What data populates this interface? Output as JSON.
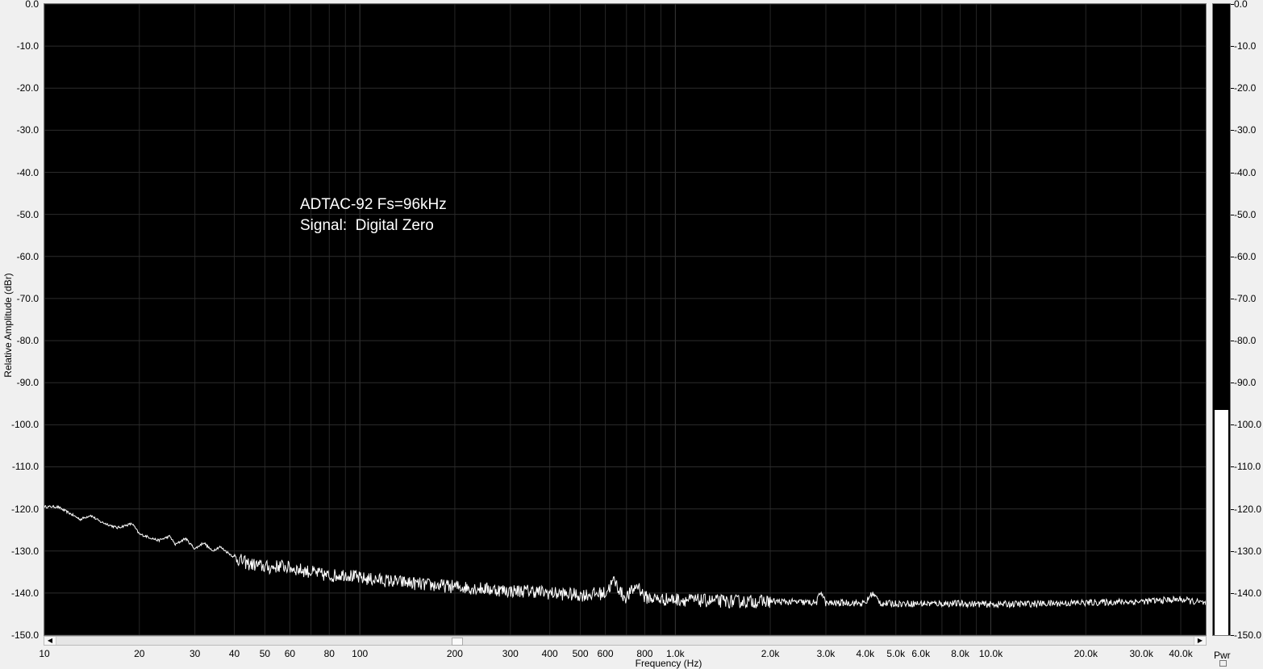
{
  "chart_data": {
    "type": "line",
    "xscale": "log",
    "xlim": [
      10,
      48000
    ],
    "ylim": [
      -150,
      0
    ],
    "ylabel": "Relative Amplitude (dBr)",
    "xlabel": "Frequency (Hz)",
    "grid": true,
    "y_ticks": [
      "0.0",
      "-10.0",
      "-20.0",
      "-30.0",
      "-40.0",
      "-50.0",
      "-60.0",
      "-70.0",
      "-80.0",
      "-90.0",
      "-100.0",
      "-110.0",
      "-120.0",
      "-130.0",
      "-140.0",
      "-150.0"
    ],
    "y_tick_values": [
      0,
      -10,
      -20,
      -30,
      -40,
      -50,
      -60,
      -70,
      -80,
      -90,
      -100,
      -110,
      -120,
      -130,
      -140,
      -150
    ],
    "x_ticks": [
      {
        "v": 10,
        "label": "10"
      },
      {
        "v": 20,
        "label": "20"
      },
      {
        "v": 30,
        "label": "30"
      },
      {
        "v": 40,
        "label": "40"
      },
      {
        "v": 50,
        "label": "50"
      },
      {
        "v": 60,
        "label": "60"
      },
      {
        "v": 80,
        "label": "80"
      },
      {
        "v": 100,
        "label": "100"
      },
      {
        "v": 200,
        "label": "200"
      },
      {
        "v": 300,
        "label": "300"
      },
      {
        "v": 400,
        "label": "400"
      },
      {
        "v": 500,
        "label": "500"
      },
      {
        "v": 600,
        "label": "600"
      },
      {
        "v": 800,
        "label": "800"
      },
      {
        "v": 1000,
        "label": "1.0k"
      },
      {
        "v": 2000,
        "label": "2.0k"
      },
      {
        "v": 3000,
        "label": "3.0k"
      },
      {
        "v": 4000,
        "label": "4.0k"
      },
      {
        "v": 5000,
        "label": "5.0k"
      },
      {
        "v": 6000,
        "label": "6.0k"
      },
      {
        "v": 8000,
        "label": "8.0k"
      },
      {
        "v": 10000,
        "label": "10.0k"
      },
      {
        "v": 20000,
        "label": "20.0k"
      },
      {
        "v": 30000,
        "label": "30.0k"
      },
      {
        "v": 40000,
        "label": "40.0k"
      }
    ],
    "annotation": [
      "ADTAC-92 Fs=96kHz",
      "Signal:  Digital Zero"
    ],
    "series": [
      {
        "color": "#ffffff",
        "x": [
          10,
          11,
          12,
          13,
          14,
          15,
          17,
          19,
          20,
          21,
          23,
          25,
          26,
          28,
          30,
          32,
          34,
          36,
          40,
          44,
          48,
          52,
          56,
          60,
          65,
          70,
          80,
          90,
          100,
          120,
          140,
          160,
          200,
          250,
          300,
          350,
          400,
          500,
          600,
          640,
          680,
          700,
          760,
          800,
          900,
          1000,
          1200,
          1500,
          2000,
          2500,
          2800,
          2900,
          3000,
          3500,
          4000,
          4200,
          4500,
          5000,
          6000,
          8000,
          10000,
          15000,
          20000,
          30000,
          40000,
          48000
        ],
        "y": [
          -119.5,
          -119.5,
          -121,
          -122.5,
          -121.5,
          -123,
          -124.5,
          -123.5,
          -126,
          -126.5,
          -127.5,
          -126.5,
          -128.5,
          -127,
          -129.5,
          -128,
          -130,
          -129,
          -131.5,
          -133,
          -133.5,
          -134,
          -133.5,
          -134,
          -134.5,
          -135,
          -136,
          -135.5,
          -136.5,
          -137,
          -137.5,
          -138,
          -138.5,
          -139,
          -139.5,
          -139.5,
          -140,
          -140.5,
          -140,
          -137,
          -140.5,
          -141,
          -138,
          -141,
          -141.5,
          -141.5,
          -141.8,
          -142,
          -142,
          -142.2,
          -142.3,
          -139.5,
          -142.5,
          -142.3,
          -142.5,
          -140,
          -142.5,
          -142.5,
          -142.5,
          -142.5,
          -142.7,
          -142.5,
          -142.3,
          -142,
          -141.5,
          -142.5
        ]
      }
    ],
    "meter": {
      "label": "Pwr",
      "ylim": [
        -150,
        0
      ],
      "value": -96.5
    }
  }
}
